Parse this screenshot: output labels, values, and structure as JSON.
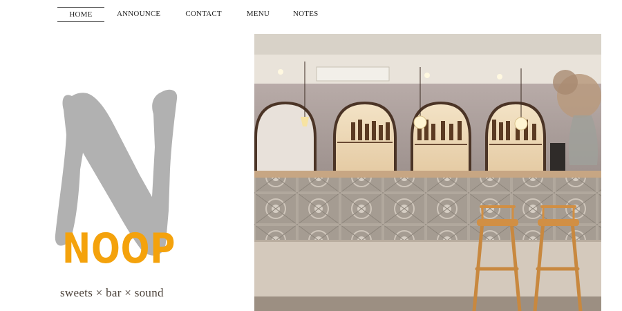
{
  "nav": {
    "items": [
      {
        "label": "HOME",
        "active": true
      },
      {
        "label": "ANNOUNCE"
      },
      {
        "label": "CONTACT"
      },
      {
        "label": "MENU"
      },
      {
        "label": "NOTES"
      }
    ]
  },
  "brand": {
    "name": "NOOP",
    "tagline": "sweets × bar × sound",
    "name_color": "#f4a20c",
    "mark_color": "#b1b1b1"
  },
  "hero": {
    "subject": "bar-interior-photo"
  }
}
